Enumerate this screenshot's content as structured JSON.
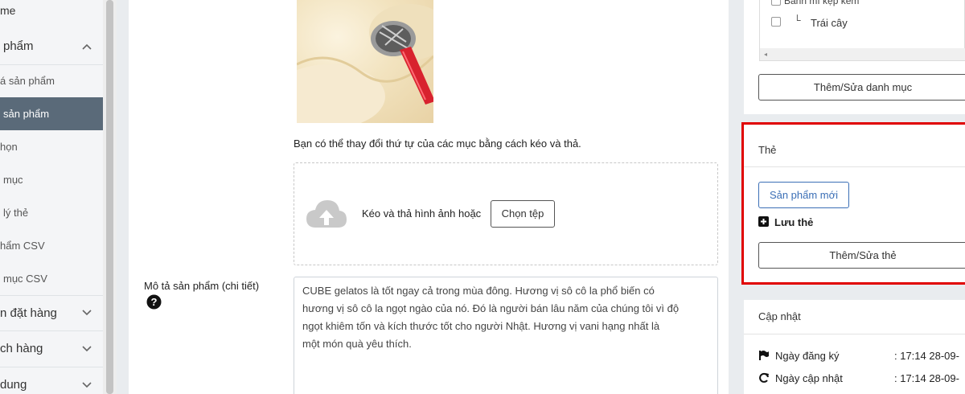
{
  "sidebar": {
    "items": [
      {
        "label": "me"
      },
      {
        "label": "phẩm"
      },
      {
        "label": "á sản phẩm"
      },
      {
        "label": "sản phẩm"
      },
      {
        "label": "họn"
      },
      {
        "label": "mục"
      },
      {
        "label": "lý thẻ"
      },
      {
        "label": "hẩm CSV"
      },
      {
        "label": "mục CSV"
      },
      {
        "label": "n đặt hàng"
      },
      {
        "label": "ch hàng"
      },
      {
        "label": "dung"
      }
    ]
  },
  "main": {
    "reorder_hint": "Bạn có thể thay đổi thứ tự của các mục bằng cách kéo và thả.",
    "drop_text": "Kéo và thả hình ảnh hoặc",
    "choose_file": "Chọn tệp",
    "description_label": "Mô tả sản phẩm (chi tiết)",
    "description_text": "CUBE gelatos là tốt ngay cả trong mùa đông. Hương vị sô cô la phổ biến có\nhương vị sô cô la ngọt ngào của nó. Đó là người bán lâu năm của chúng tôi vì độ\nngọt khiêm tốn và kích thước tốt cho người Nhật. Hương vị vani hạng nhất là\nmột món quà yêu thích."
  },
  "category_panel": {
    "item_partial": "Bánh mì kẹp kem",
    "item_fruit_prefix": "└",
    "item_fruit": "Trái cây",
    "edit_button": "Thêm/Sửa danh mục"
  },
  "tag_panel": {
    "title": "Thẻ",
    "tag_chip": "Sản phẩm mới",
    "save_label": "Lưu thẻ",
    "edit_button": "Thêm/Sửa thẻ",
    "highlight_color": "#e00000"
  },
  "update_panel": {
    "title": "Cập nhật",
    "rows": [
      {
        "label": "Ngày đăng ký",
        "value": ": 17:14 28-09-"
      },
      {
        "label": "Ngày cập nhật",
        "value": ": 17:14 28-09-"
      }
    ]
  },
  "icons": {
    "plus_square": "plus-square-icon",
    "help": "question-circle-icon",
    "flag": "flag-icon",
    "refresh": "refresh-icon",
    "upload_cloud": "cloud-upload-icon"
  }
}
